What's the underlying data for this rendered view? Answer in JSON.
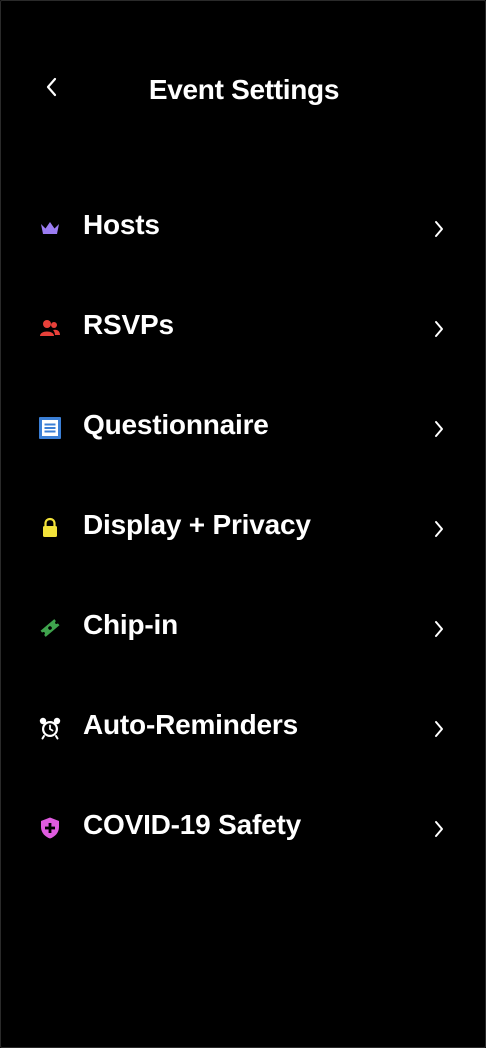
{
  "header": {
    "title": "Event Settings",
    "back_icon": "chevron-left-icon"
  },
  "menu": {
    "items": [
      {
        "label": "Hosts",
        "icon": "crown-icon",
        "icon_color": "#9b7cf2"
      },
      {
        "label": "RSVPs",
        "icon": "users-icon",
        "icon_color": "#e8413a"
      },
      {
        "label": "Questionnaire",
        "icon": "form-icon",
        "icon_color": "#3b7fd6"
      },
      {
        "label": "Display + Privacy",
        "icon": "lock-icon",
        "icon_color": "#f2e23a"
      },
      {
        "label": "Chip-in",
        "icon": "ticket-icon",
        "icon_color": "#3fa34d"
      },
      {
        "label": "Auto-Reminders",
        "icon": "alarm-clock-icon",
        "icon_color": "#ffffff"
      },
      {
        "label": "COVID-19 Safety",
        "icon": "shield-plus-icon",
        "icon_color": "#e05be0"
      }
    ]
  },
  "colors": {
    "background": "#000000",
    "text": "#ffffff"
  }
}
